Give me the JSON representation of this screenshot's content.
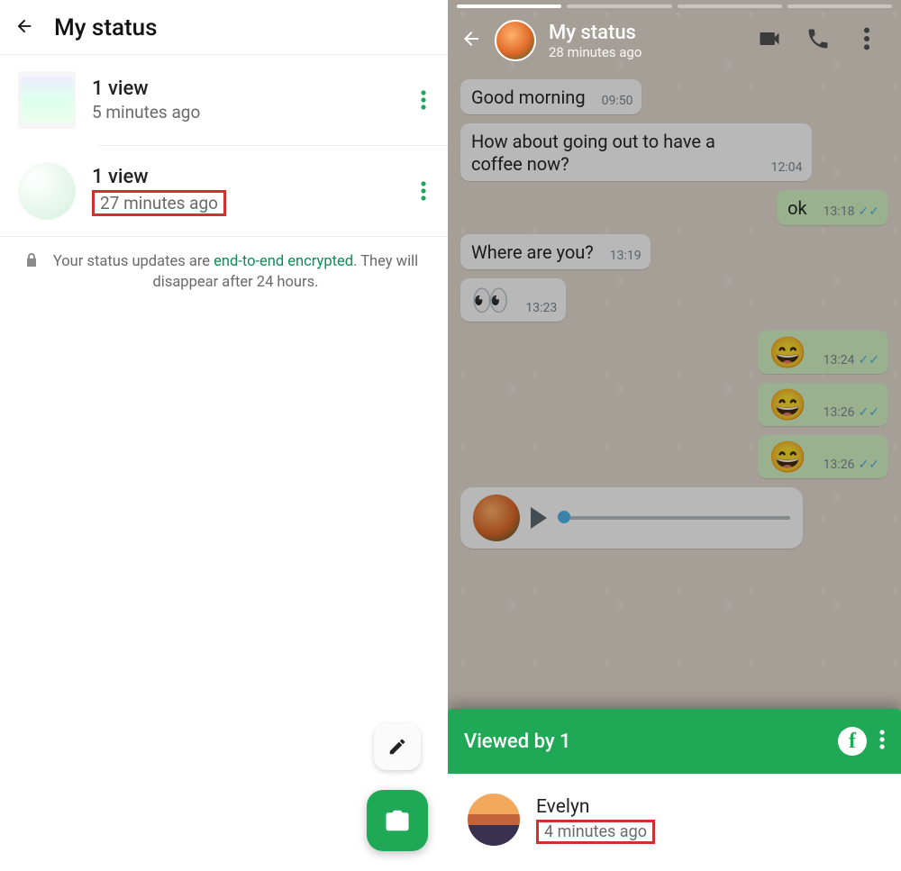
{
  "left": {
    "title": "My status",
    "statuses": [
      {
        "views": "1 view",
        "time": "5 minutes ago"
      },
      {
        "views": "1 view",
        "time": "27 minutes ago"
      }
    ],
    "note_prefix": "Your status updates are ",
    "note_encrypted": "end-to-end encrypted",
    "note_suffix": ". They will disappear after 24 hours."
  },
  "right": {
    "header": {
      "title": "My status",
      "subtitle": "28 minutes ago"
    },
    "contact_name_bg": "Evelyn",
    "messages": [
      {
        "dir": "in",
        "text": "Good morning",
        "time": "09:50"
      },
      {
        "dir": "in",
        "text": "How about going out to have a coffee now?",
        "time": "12:04"
      },
      {
        "dir": "out",
        "text": "ok",
        "time": "13:18",
        "ticks": true
      },
      {
        "dir": "in",
        "text": "Where are you?",
        "time": "13:19"
      },
      {
        "dir": "in",
        "text": "👀",
        "time": "13:23",
        "emoji": true
      },
      {
        "dir": "out",
        "text": "😄",
        "time": "13:24",
        "ticks": true,
        "emoji": true
      },
      {
        "dir": "out",
        "text": "😄",
        "time": "13:26",
        "ticks": true,
        "emoji": true
      },
      {
        "dir": "out",
        "text": "😄",
        "time": "13:26",
        "ticks": true,
        "emoji": true
      }
    ],
    "sheet": {
      "label": "Viewed by 1",
      "viewer": {
        "name": "Evelyn",
        "time": "4 minutes ago"
      }
    }
  },
  "colors": {
    "accent_green": "#1fa855",
    "bubble_out": "#d6f6c7",
    "highlight_red": "#d42f2f",
    "tick_blue": "#4fb6ec"
  }
}
